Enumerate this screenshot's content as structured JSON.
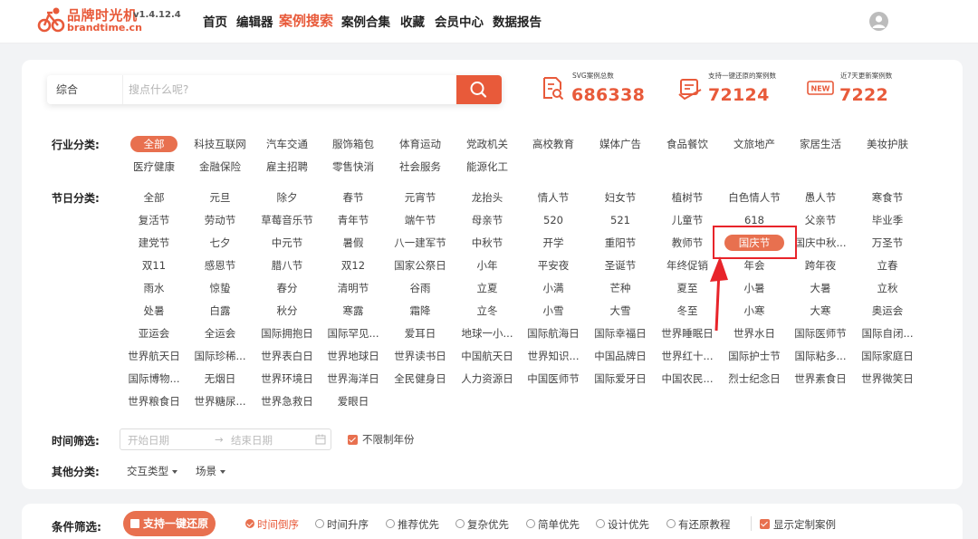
{
  "brand": {
    "name_cn": "品牌时光机",
    "version": "v1.4.12.4",
    "name_en": "brandtime.cn",
    "accent": "#e85a3a"
  },
  "nav": [
    "首页",
    "编辑器",
    "案例搜索",
    "案例合集",
    "收藏",
    "会员中心",
    "数据报告"
  ],
  "nav_active": "案例搜索",
  "search": {
    "type": "综合",
    "placeholder": "搜点什么呢?",
    "button_icon": "search-icon"
  },
  "stats": [
    {
      "label": "SVG案例总数",
      "value": "686338",
      "icon": "document-search-icon"
    },
    {
      "label": "支持一键还原的案例数",
      "value": "72124",
      "icon": "restore-icon"
    },
    {
      "label": "近7天更新案例数",
      "value": "7222",
      "icon": "new-badge-icon",
      "badge": "NEW"
    }
  ],
  "industry": {
    "label": "行业分类:",
    "selected": "全部",
    "rows": [
      [
        "全部",
        "科技互联网",
        "汽车交通",
        "服饰箱包",
        "体育运动",
        "党政机关",
        "高校教育",
        "媒体广告",
        "食品餐饮",
        "文旅地产",
        "家居生活",
        "美妆护肤"
      ],
      [
        "医疗健康",
        "金融保险",
        "雇主招聘",
        "零售快消",
        "社会服务",
        "能源化工"
      ]
    ]
  },
  "festival": {
    "label": "节日分类:",
    "selected": "国庆节",
    "rows": [
      [
        "全部",
        "元旦",
        "除夕",
        "春节",
        "元宵节",
        "龙抬头",
        "情人节",
        "妇女节",
        "植树节",
        "白色情人节",
        "愚人节",
        "寒食节"
      ],
      [
        "复活节",
        "劳动节",
        "草莓音乐节",
        "青年节",
        "端午节",
        "母亲节",
        "520",
        "521",
        "儿童节",
        "618",
        "父亲节",
        "毕业季"
      ],
      [
        "建党节",
        "七夕",
        "中元节",
        "暑假",
        "八一建军节",
        "中秋节",
        "开学",
        "重阳节",
        "教师节",
        "国庆节",
        "国庆中秋...",
        "万圣节"
      ],
      [
        "双11",
        "感恩节",
        "腊八节",
        "双12",
        "国家公祭日",
        "小年",
        "平安夜",
        "圣诞节",
        "年终促销",
        "年会",
        "跨年夜",
        "立春"
      ],
      [
        "雨水",
        "惊蛰",
        "春分",
        "清明节",
        "谷雨",
        "立夏",
        "小满",
        "芒种",
        "夏至",
        "小暑",
        "大暑",
        "立秋"
      ],
      [
        "处暑",
        "白露",
        "秋分",
        "寒露",
        "霜降",
        "立冬",
        "小雪",
        "大雪",
        "冬至",
        "小寒",
        "大寒",
        "奥运会"
      ],
      [
        "亚运会",
        "全运会",
        "国际拥抱日",
        "国际罕见...",
        "爱耳日",
        "地球一小...",
        "国际航海日",
        "国际幸福日",
        "世界睡眠日",
        "世界水日",
        "国际医师节",
        "国际自闭..."
      ],
      [
        "世界航天日",
        "国际珍稀...",
        "世界表白日",
        "世界地球日",
        "世界读书日",
        "中国航天日",
        "世界知识...",
        "中国品牌日",
        "世界红十...",
        "国际护士节",
        "国际粘多...",
        "国际家庭日"
      ],
      [
        "国际博物...",
        "无烟日",
        "世界环境日",
        "世界海洋日",
        "全民健身日",
        "人力资源日",
        "中国医师节",
        "国际爱牙日",
        "中国农民...",
        "烈士纪念日",
        "世界素食日",
        "世界微笑日"
      ],
      [
        "世界粮食日",
        "世界糖尿...",
        "世界急救日",
        "爱眼日"
      ]
    ]
  },
  "time_filter": {
    "label": "时间筛选:",
    "start_placeholder": "开始日期",
    "end_placeholder": "结束日期",
    "unlimited_label": "不限制年份",
    "unlimited_checked": true
  },
  "other": {
    "label": "其他分类:",
    "dropdowns": [
      "交互类型",
      "场景"
    ]
  },
  "conditions": {
    "label": "条件筛选:",
    "restore_button": "支持一键还原",
    "options": [
      "时间倒序",
      "时间升序",
      "推荐优先",
      "复杂优先",
      "简单优先",
      "设计优先",
      "有还原教程"
    ],
    "selected_option": "时间倒序",
    "custom_label": "显示定制案例",
    "custom_checked": true
  }
}
